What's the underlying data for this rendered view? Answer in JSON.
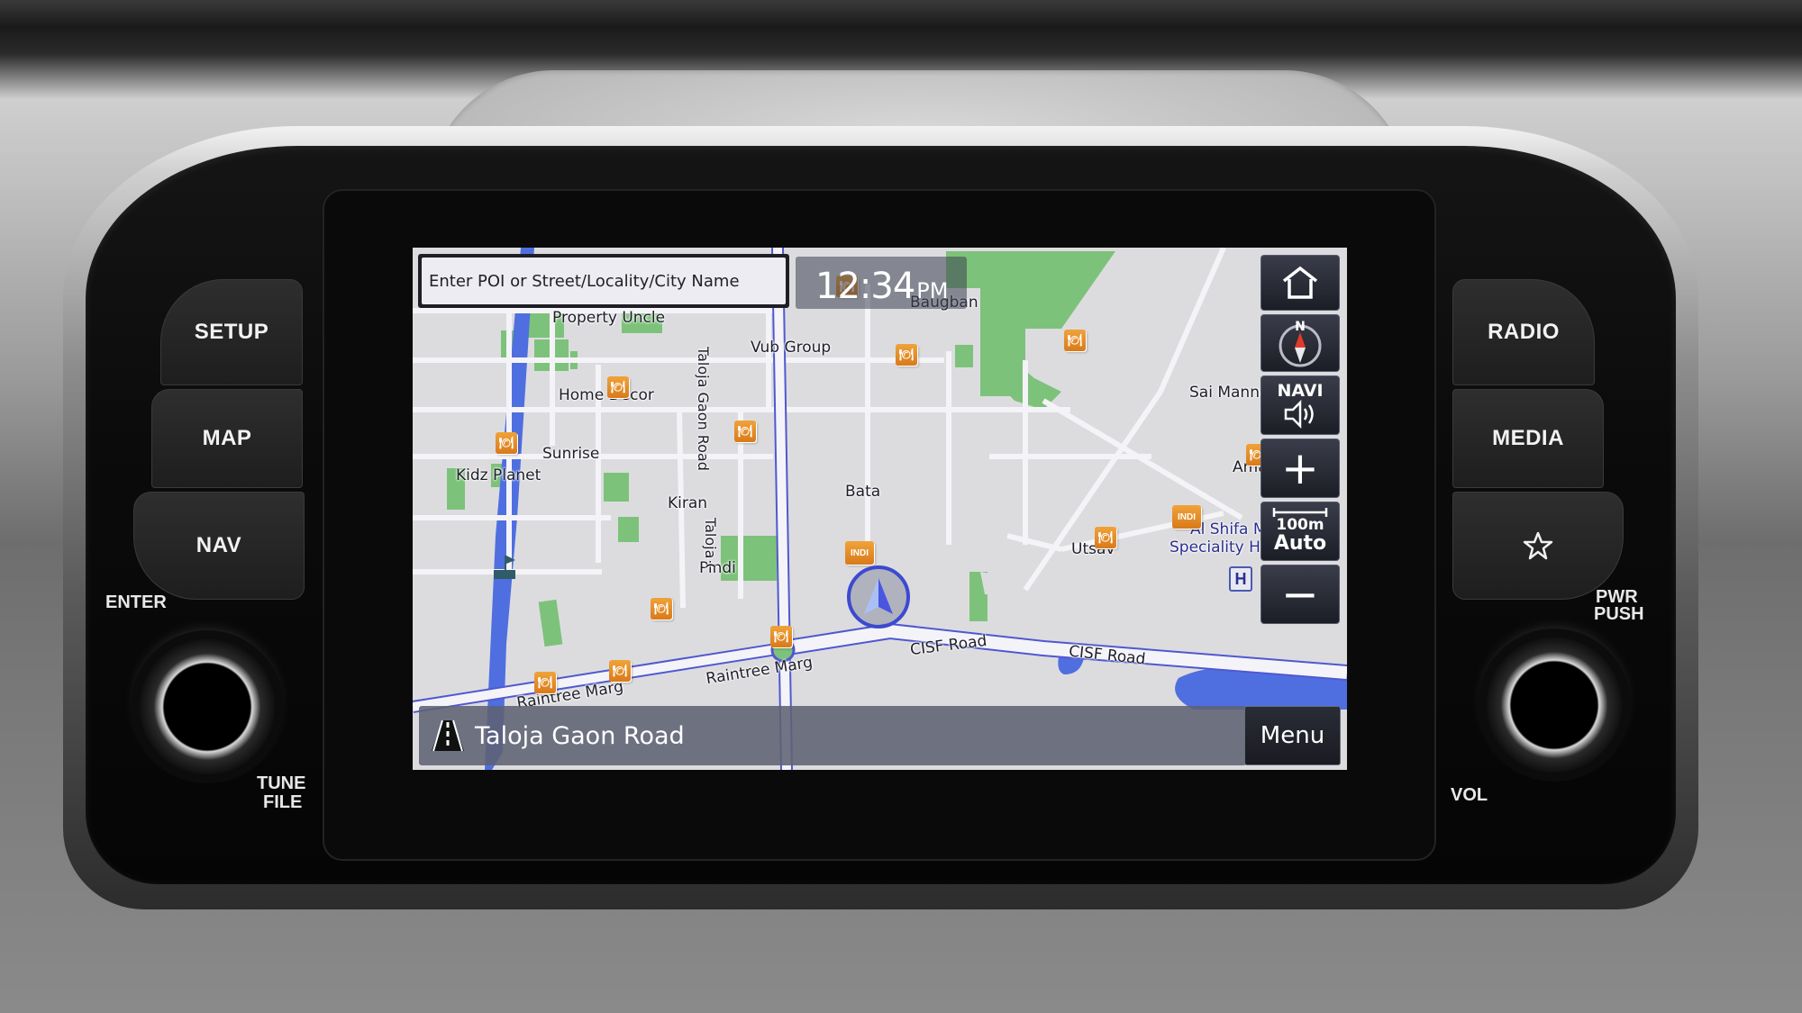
{
  "hardware": {
    "left_buttons": [
      {
        "label": "SETUP"
      },
      {
        "label": "MAP"
      },
      {
        "label": "NAV"
      }
    ],
    "right_buttons": [
      {
        "label": "RADIO"
      },
      {
        "label": "MEDIA"
      },
      {
        "label": "",
        "icon": "star-icon"
      }
    ],
    "left_knob": {
      "top_label": "ENTER",
      "bottom_label_1": "TUNE",
      "bottom_label_2": "FILE"
    },
    "right_knob": {
      "top_label_1": "PWR",
      "top_label_2": "PUSH",
      "bottom_label": "VOL"
    }
  },
  "screen": {
    "search": {
      "placeholder": "Enter POI or Street/Locality/City Name"
    },
    "clock": {
      "time": "12:34",
      "ampm": "PM"
    },
    "side_controls": {
      "home_icon": "home-icon",
      "compass": {
        "north_label": "N",
        "icon": "compass-icon"
      },
      "navi_volume": {
        "label": "NAVI",
        "icon": "speaker-icon"
      },
      "zoom_in": {
        "label": "+"
      },
      "scale": {
        "distance": "100m",
        "mode": "Auto"
      },
      "zoom_out": {
        "label": "−"
      }
    },
    "current_road": {
      "name": "Taloja Gaon Road",
      "icon": "road-icon"
    },
    "menu_label": "Menu",
    "map_labels": [
      {
        "text": "Property Uncle"
      },
      {
        "text": "Baugban"
      },
      {
        "text": "Vub Group"
      },
      {
        "text": "Home Decor"
      },
      {
        "text": "Sunrise"
      },
      {
        "text": "Kidz Planet"
      },
      {
        "text": "Bata"
      },
      {
        "text": "Kiran"
      },
      {
        "text": "Pindi"
      },
      {
        "text": "Utsav"
      },
      {
        "text": "Sai Mannat"
      },
      {
        "text": "Aman"
      },
      {
        "text": "Al Shifa Multi"
      },
      {
        "text": "Speciality Hospital"
      },
      {
        "text": "Raintree Marg"
      },
      {
        "text": "Raintree Marg"
      },
      {
        "text": "CISF Road"
      },
      {
        "text": "CISF Road"
      },
      {
        "text": "Taloja Gaon Road"
      },
      {
        "text": "Taloja Gaon Road"
      }
    ],
    "poi_glyph": "🍽",
    "indi_label": "INDI",
    "hospital_label": "H",
    "colors": {
      "map_bg": "#dcdcdf",
      "road": "#f4f4f8",
      "park": "#7dc27a",
      "water": "#4f6fe0",
      "poi": "#e08a22",
      "vehicle": "#3c4ad0"
    }
  }
}
